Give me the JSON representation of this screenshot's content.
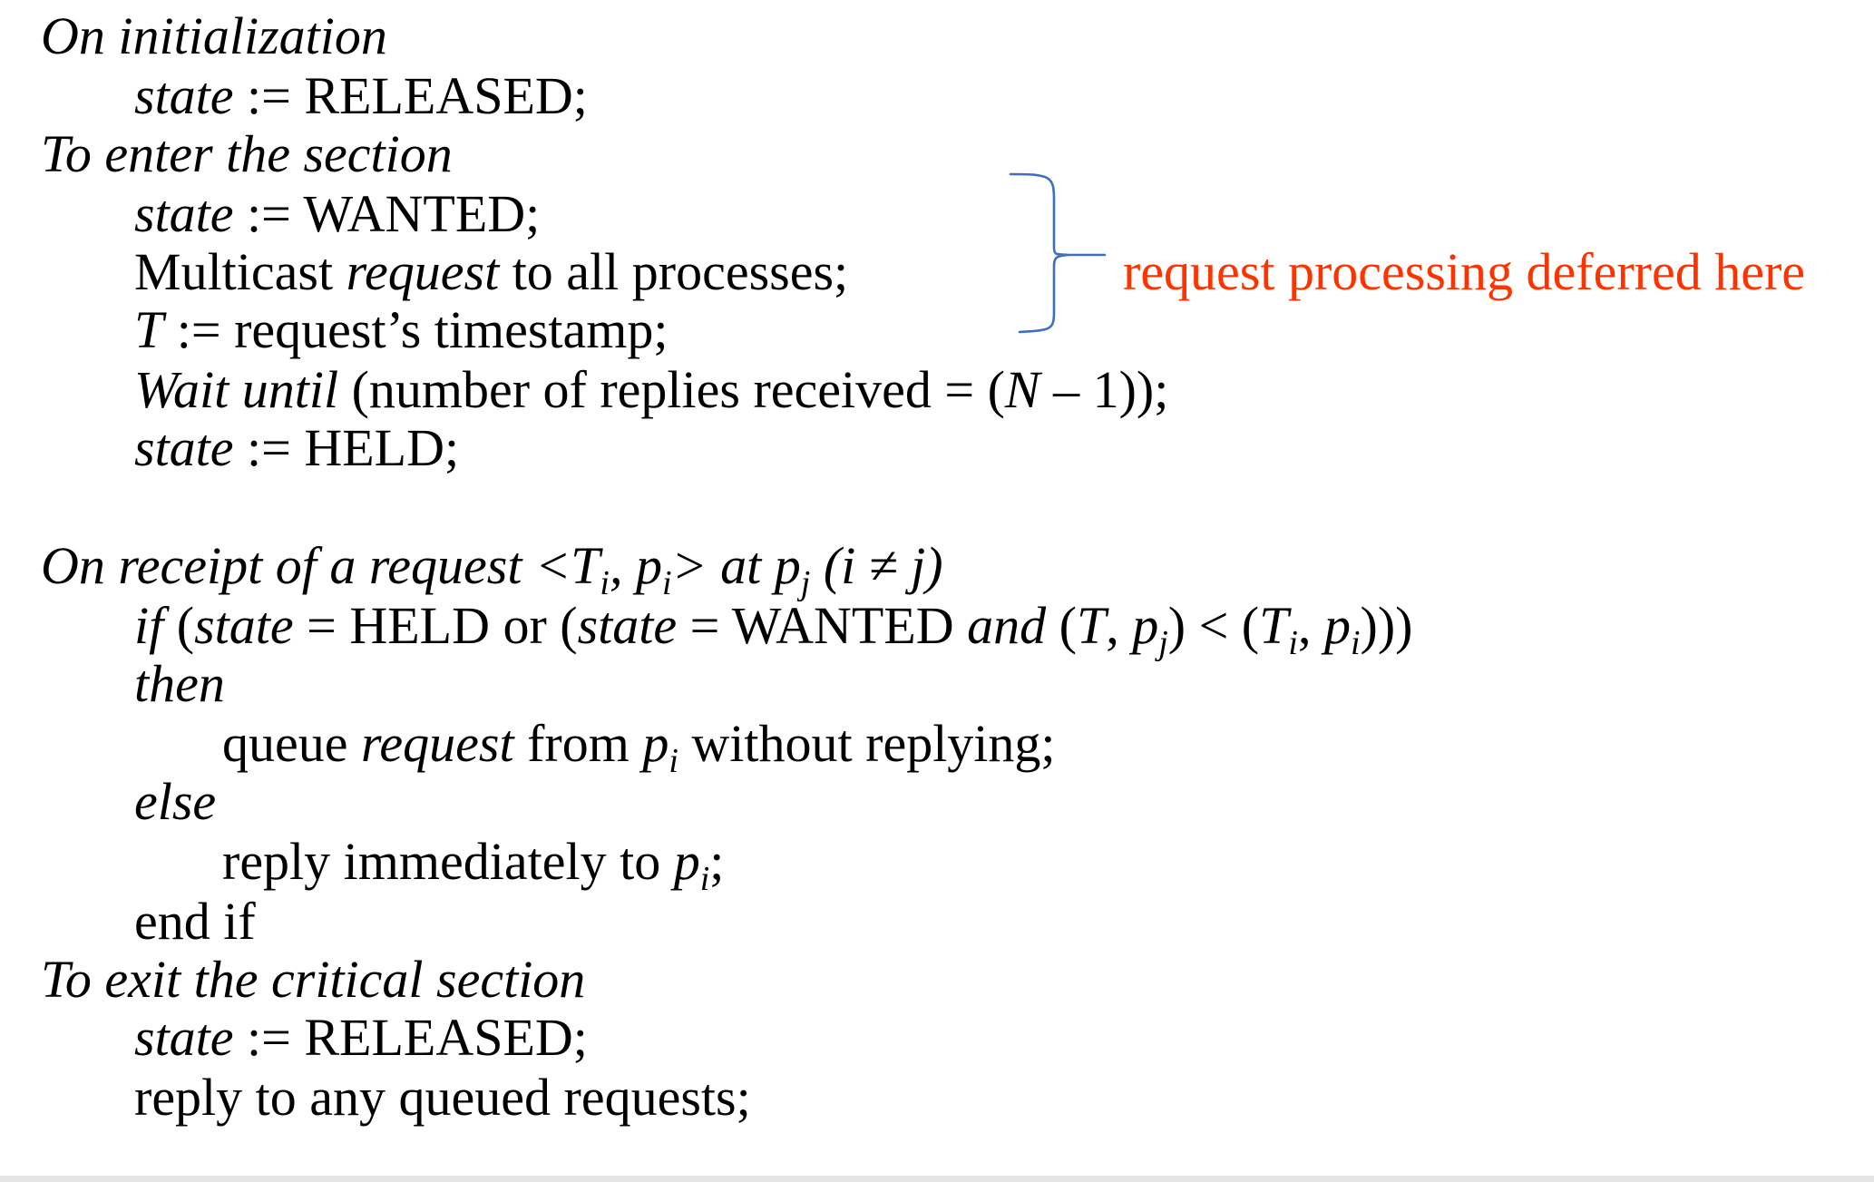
{
  "lines": {
    "l0": [
      "On initialization"
    ],
    "l1": [
      "state",
      " := RELEASED;"
    ],
    "l2": [
      "To enter the section"
    ],
    "l3": [
      "state",
      " := WANTED;"
    ],
    "l4": [
      "Multicast ",
      "request",
      " to all processes;"
    ],
    "l5": [
      "T",
      " := request’s timestamp;"
    ],
    "l6": [
      "Wait until",
      " (number of replies received = (",
      "N",
      " – 1));"
    ],
    "l7": [
      "state",
      " := HELD;"
    ],
    "l8": [
      "On receipt of a request <T",
      "i",
      ", p",
      "i",
      "> at p",
      "j",
      " (i ≠ j)"
    ],
    "l9": [
      "if",
      "  (",
      "state",
      " = HELD or (",
      "state",
      " = WANTED ",
      "and",
      " (",
      "T",
      ", ",
      "p",
      "j",
      ") < (",
      "T",
      "i",
      ", ",
      "p",
      "i",
      ")))"
    ],
    "l10": [
      "then"
    ],
    "l11": [
      "queue ",
      "request",
      " from ",
      "p",
      "i",
      " without replying;"
    ],
    "l12": [
      "else"
    ],
    "l13": [
      "reply immediately to ",
      "p",
      "i",
      ";"
    ],
    "l14": [
      "end if"
    ],
    "l15": [
      "To exit the critical section"
    ],
    "l16": [
      "state",
      " := RELEASED;"
    ],
    "l17": [
      "reply to any queued requests;"
    ]
  },
  "annotation": {
    "text": "request processing deferred here",
    "color": "#ff3300",
    "brace_color": "#3d6fc2"
  }
}
